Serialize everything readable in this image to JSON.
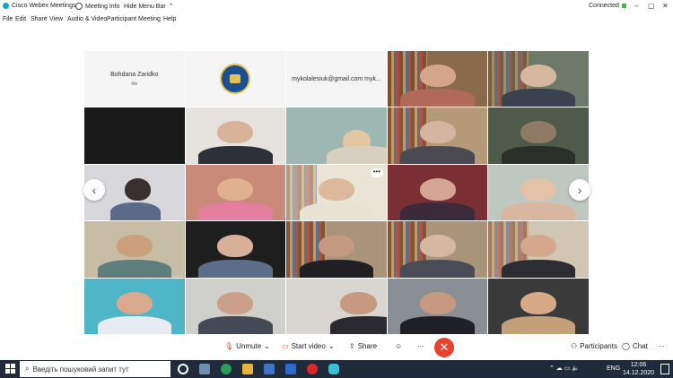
{
  "titlebar": {
    "app_title": "Cisco Webex Meetings",
    "meeting_info": "Meeting Info",
    "hide_menu_bar": "Hide Menu Bar",
    "connected": "Connected",
    "app_icon_color": "#1aa3c9",
    "connected_color": "#4cae4c"
  },
  "menu": {
    "items": [
      "File",
      "Edit",
      "Share",
      "View",
      "Audio & Video",
      "Participant",
      "Meeting",
      "Help"
    ]
  },
  "tiles": {
    "name1": "Bohdana Zaridko",
    "name1_sub": "Me",
    "email": "mykolalesiuk@gmail.com myk...",
    "more_dots": "•••"
  },
  "controls": {
    "unmute": "Unmute",
    "start_video": "Start video",
    "share": "Share",
    "more": "···",
    "end": "✕",
    "participants": "Participants",
    "chat": "Chat",
    "overflow": "···",
    "end_color": "#e8412e",
    "mute_color": "#e8412e"
  },
  "taskbar": {
    "search_placeholder": "Введіть пошуковий запит тут",
    "lang": "ENG",
    "time": "12:06",
    "date": "14.12.2020"
  },
  "nav": {
    "prev": "‹",
    "next": "›"
  }
}
